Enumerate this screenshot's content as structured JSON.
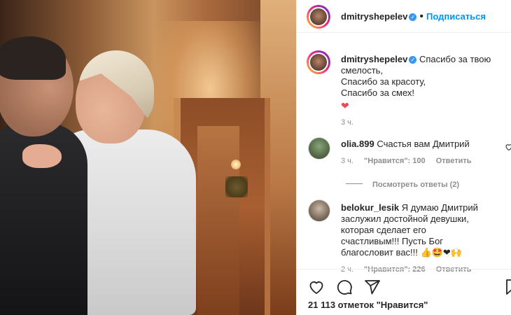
{
  "post": {
    "author": "dmitryshepelev",
    "follow_label": "Подписаться",
    "dot": "•"
  },
  "caption": {
    "author": "dmitryshepelev",
    "line1": "Спасибо за твою",
    "line2": "смелость,",
    "line3": "Спасибо за красоту,",
    "line4": "Спасибо за смех!",
    "emoji": "❤",
    "time": "3 ч."
  },
  "comments": [
    {
      "user": "olia.899",
      "text": "Счастья вам Дмитрий",
      "time": "3 ч.",
      "likes": "\"Нравится\": 100",
      "reply": "Ответить",
      "view_replies": "Посмотреть ответы (2)"
    },
    {
      "user": "belokur_lesik",
      "line1": "Я думаю Дмитрий",
      "line2": "заслужил достойной девушки,",
      "line3": "которая сделает его",
      "line4": "счастливым!!! Пусть Бог",
      "line5": "благословит вас!!!",
      "emojis": "👍🤩❤🙌",
      "time": "2 ч.",
      "likes": "\"Нравится\": 226",
      "reply": "Ответить"
    }
  ],
  "likes_text": "21 113 отметок \"Нравится\"",
  "icons": [
    "heart-icon",
    "comment-icon",
    "share-icon",
    "bookmark-icon",
    "verified-icon"
  ],
  "colors": {
    "accent": "#0095f6",
    "verified": "#3897f0",
    "heart": "#ed4956"
  }
}
